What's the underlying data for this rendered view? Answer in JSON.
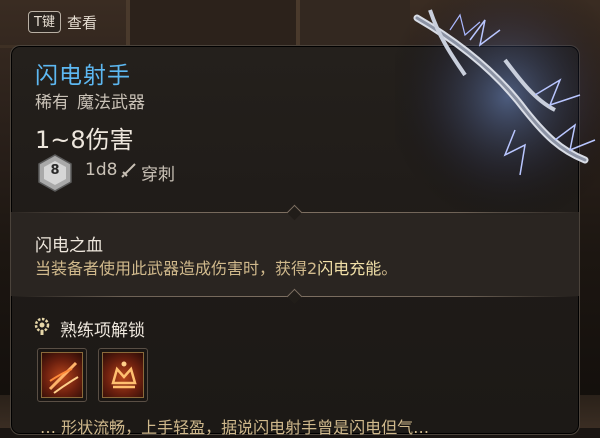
{
  "hint": {
    "key": "T键",
    "label": "查看"
  },
  "item": {
    "name": "闪电射手",
    "rarity": "稀有",
    "category": "魔法武器",
    "damage_range": "1~8伤害",
    "die_face": "8",
    "damage_dice": "1d8",
    "damage_type": "穿刺"
  },
  "ability": {
    "title": "闪电之血",
    "desc_before": "当装备者使用此武器造成伤害时，获得2",
    "desc_highlight": "闪电充能",
    "desc_after": "。"
  },
  "proficiency": {
    "title": "熟练项解锁"
  },
  "bottom_text": "…  形状流畅，上手轻盈，据说闪电射手曾是闪电但气…",
  "colors": {
    "name": "#5db8f2",
    "desc": "#d0b98c",
    "highlight": "#f1e0a8",
    "panel": "#1f1b18"
  },
  "icons": [
    "t-key-icon",
    "d8-die-icon",
    "sword-icon",
    "unlock-gear-icon",
    "proficiency-slash-icon",
    "proficiency-crown-icon",
    "lightning-weapon-icon"
  ]
}
